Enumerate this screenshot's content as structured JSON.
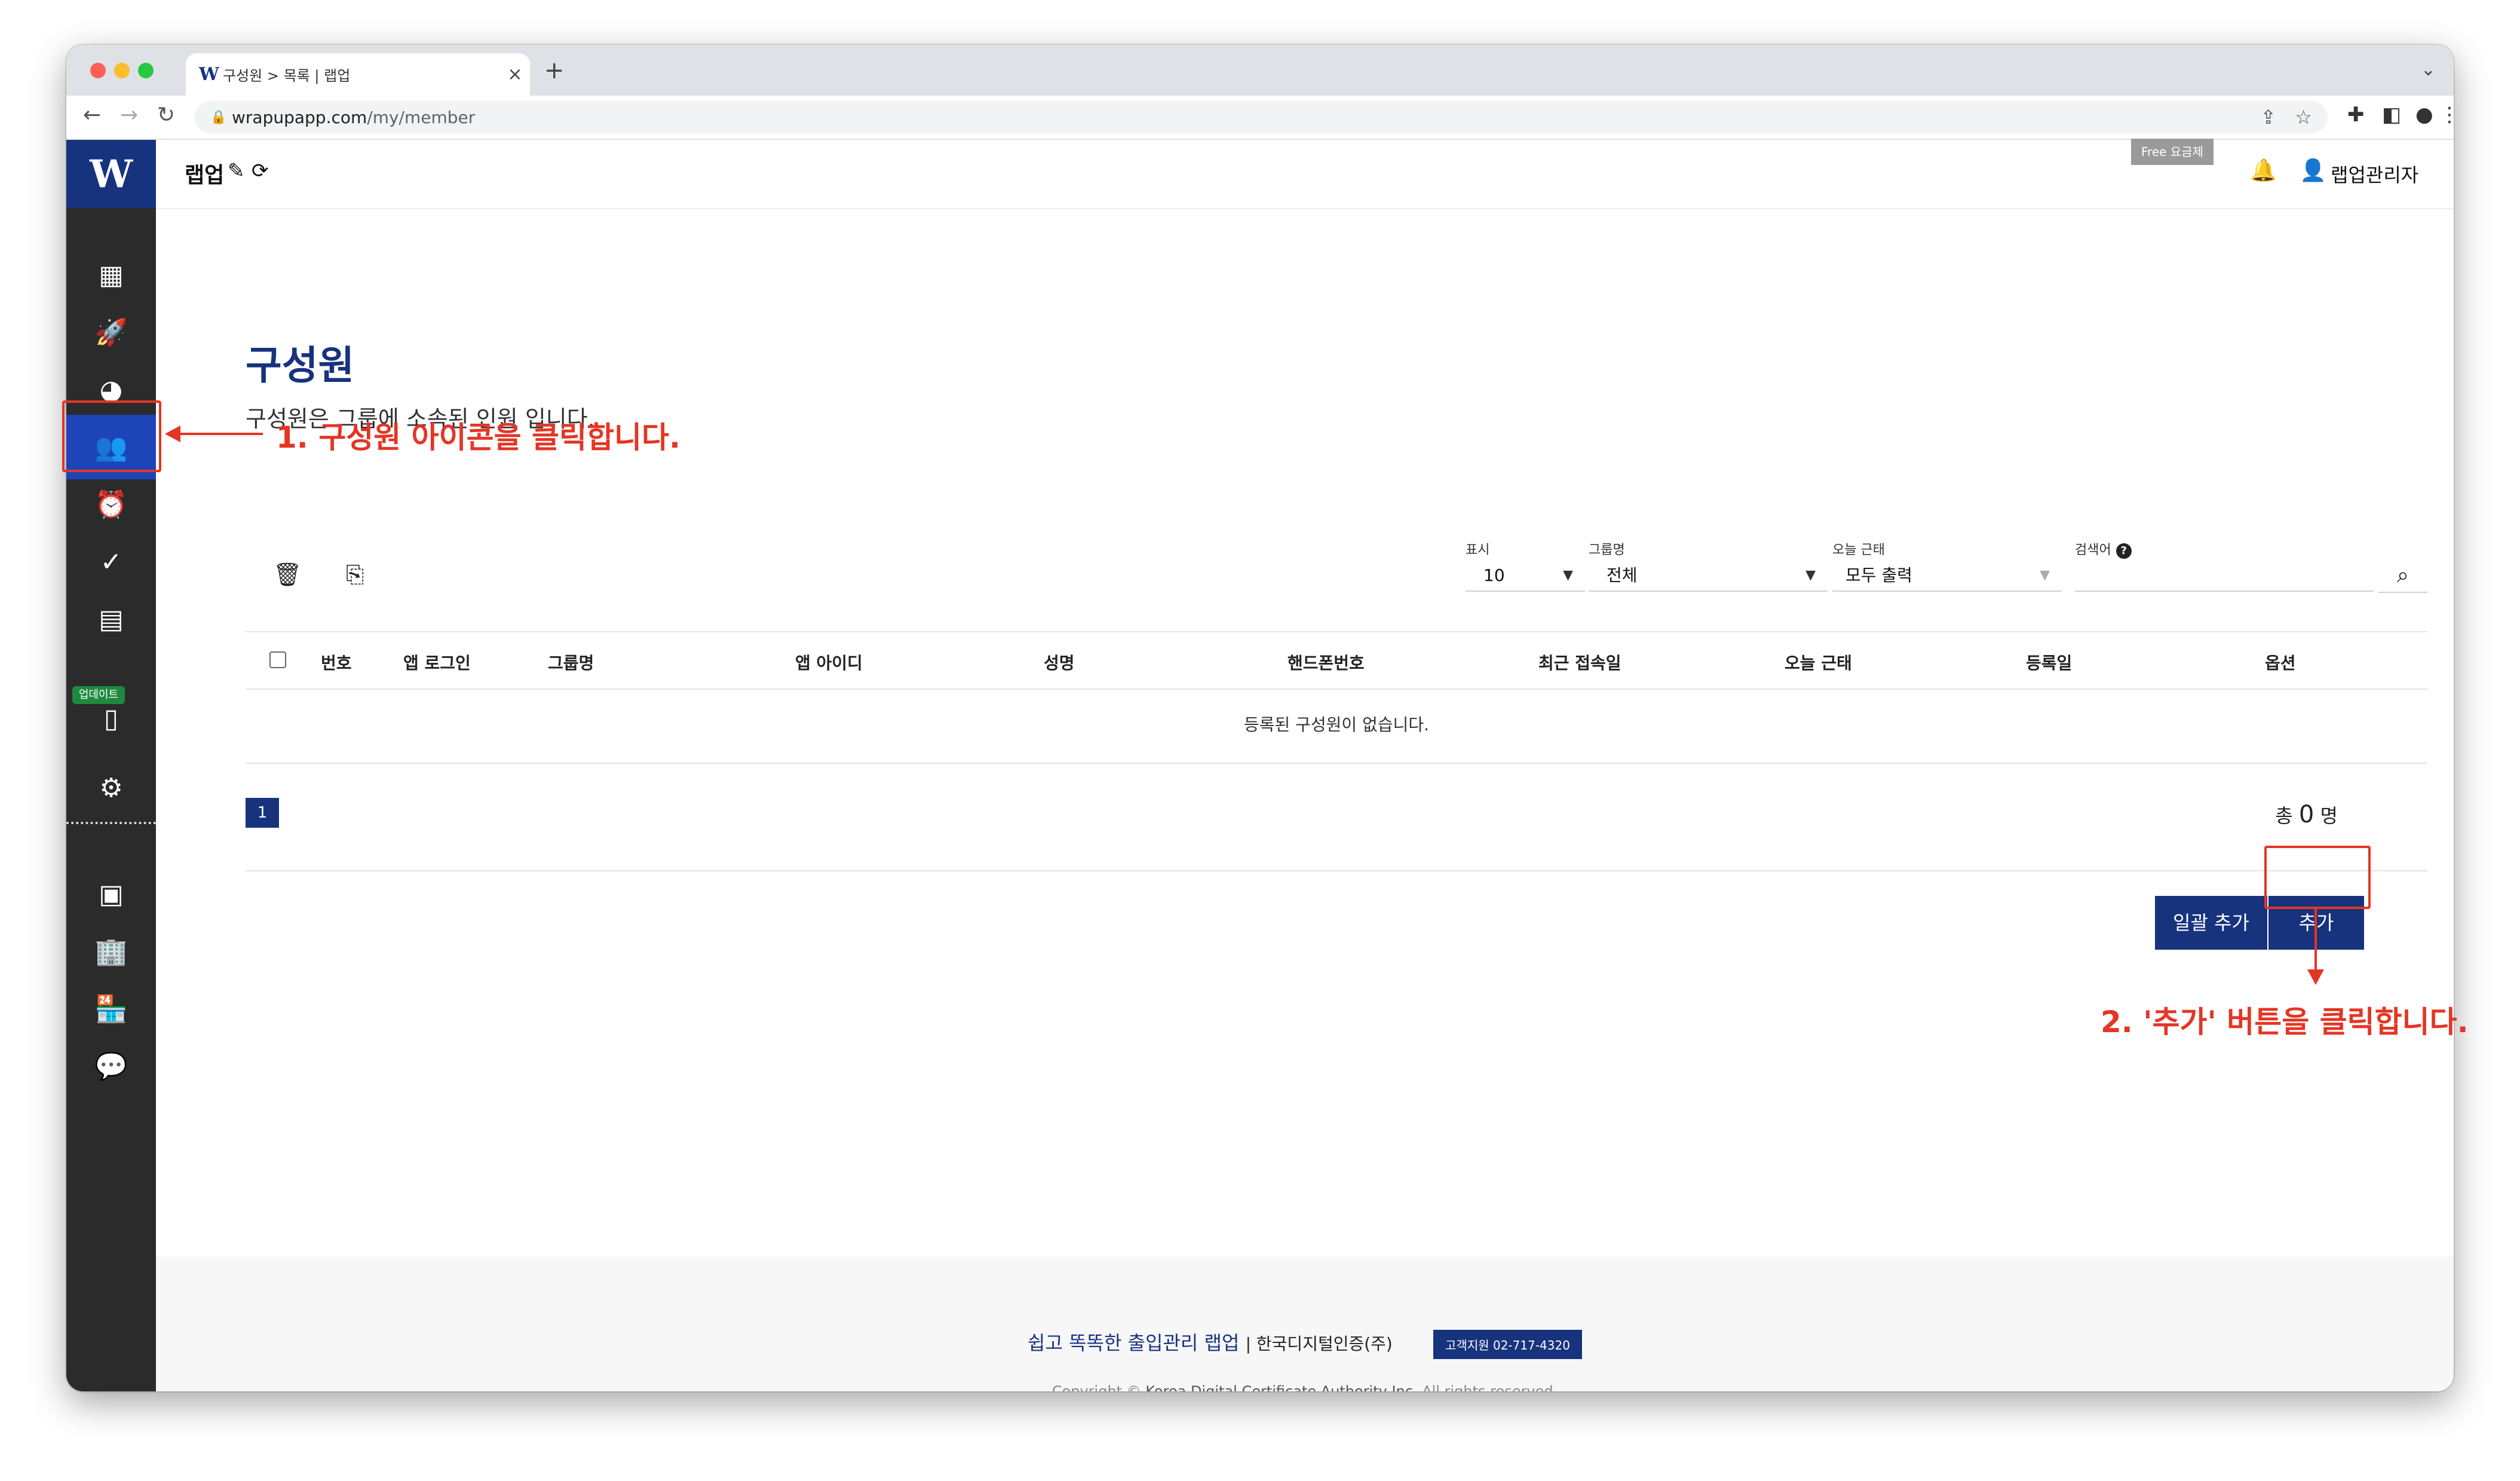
{
  "browser": {
    "tab_title": "구성원 > 목록 | 랩업",
    "tab_favicon": "W",
    "url_domain": "wrapupapp.com",
    "url_path": "/my/member"
  },
  "app": {
    "logo": "W",
    "brand": "랩업",
    "free_badge": "Free 요금제",
    "user_name": "랩업관리자",
    "sidebar_badge": "업데이트"
  },
  "page": {
    "title": "구성원",
    "description": "구성원은 그룹에 소속된 인원 입니다."
  },
  "filters": {
    "display_label": "표시",
    "display_value": "10",
    "group_label": "그룹명",
    "group_value": "전체",
    "attendance_label": "오늘 근태",
    "attendance_value": "모두 출력",
    "search_label": "검색어",
    "search_placeholder": ""
  },
  "table": {
    "columns": [
      "번호",
      "앱 로그인",
      "그룹명",
      "앱 아이디",
      "성명",
      "핸드폰번호",
      "최근 접속일",
      "오늘 근태",
      "등록일",
      "옵션"
    ],
    "empty_message": "등록된 구성원이 없습니다."
  },
  "pagination": {
    "current_page": "1",
    "total_prefix": "총",
    "total_count": "0",
    "total_suffix": "명"
  },
  "actions": {
    "bulk_add": "일괄 추가",
    "add": "추가"
  },
  "footer": {
    "slogan": "쉽고 똑똑한 출입관리 랩업",
    "company": "| 한국디지털인증(주)",
    "support": "고객지원 02-717-4320",
    "copyright_prefix": "Copyright © ",
    "copyright_company": "Korea Digital Certificate Authority Inc.",
    "copyright_suffix": " All rights reserved."
  },
  "annotations": {
    "step1": "1. 구성원 아이콘을 클릭합니다.",
    "step2": "2. '추가' 버튼을 클릭합니다."
  },
  "colors": {
    "brand_navy": "#17337e",
    "active_blue": "#1d45b8",
    "sidebar_bg": "#2b2b2b",
    "annotation_red": "#e53524",
    "update_green": "#1e8a3e"
  }
}
